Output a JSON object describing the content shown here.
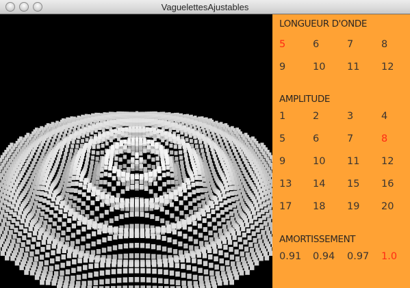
{
  "window": {
    "title": "VaguelettesAjustables"
  },
  "colors": {
    "panel": "#ffa234",
    "selected": "#ff2b14",
    "text": "#3a3430"
  },
  "controls": {
    "wavelength": {
      "title": "LONGUEUR D'ONDE",
      "options": [
        "5",
        "6",
        "7",
        "8",
        "9",
        "10",
        "11",
        "12"
      ],
      "selected": "5"
    },
    "amplitude": {
      "title": "AMPLITUDE",
      "options": [
        "1",
        "2",
        "3",
        "4",
        "5",
        "6",
        "7",
        "8",
        "9",
        "10",
        "11",
        "12",
        "13",
        "14",
        "15",
        "16",
        "17",
        "18",
        "19",
        "20"
      ],
      "selected": "8"
    },
    "damping": {
      "title": "AMORTISSEMENT",
      "options": [
        "0.91",
        "0.94",
        "0.97",
        "1.0"
      ],
      "selected": "1.0"
    }
  }
}
